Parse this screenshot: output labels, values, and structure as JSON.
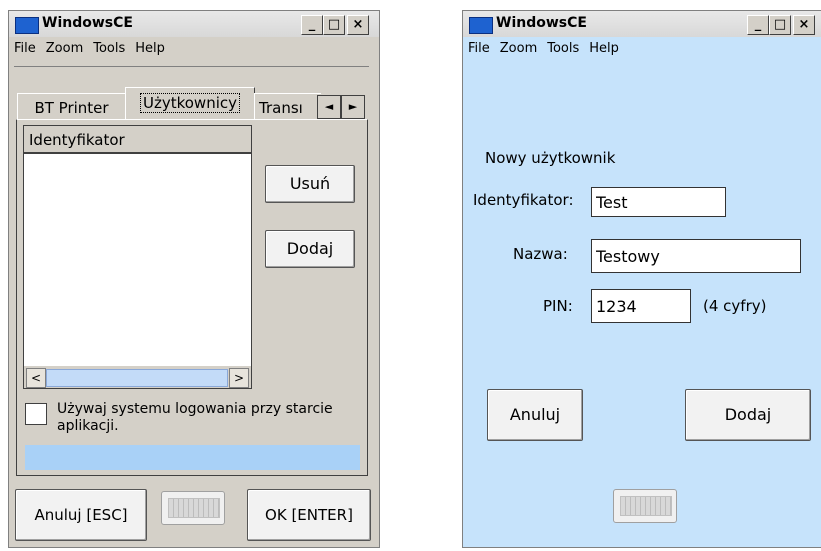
{
  "left_window": {
    "title": "WindowsCE",
    "controls": {
      "minimize": "_",
      "maximize": "□",
      "close": "×"
    },
    "menu": [
      "File",
      "Zoom",
      "Tools",
      "Help"
    ],
    "tabs": [
      {
        "label": "BT Printer",
        "selected": false
      },
      {
        "label": "Użytkownicy",
        "selected": true
      },
      {
        "label": "Transı",
        "selected": false
      }
    ],
    "tab_scroll": {
      "left": "◄",
      "right": "►"
    },
    "list_header": "Identyfikator",
    "hscroll": {
      "left": "<",
      "right": ">"
    },
    "buttons": {
      "remove": "Usuń",
      "add": "Dodaj"
    },
    "checkbox_label": "Używaj systemu logowania przy starcie aplikacji.",
    "checkbox_checked": false,
    "bottom": {
      "cancel": "Anuluj [ESC]",
      "ok": "OK [ENTER]"
    }
  },
  "right_window": {
    "title": "WindowsCE",
    "controls": {
      "minimize": "_",
      "maximize": "□",
      "close": "×"
    },
    "menu": [
      "File",
      "Zoom",
      "Tools",
      "Help"
    ],
    "heading": "Nowy użytkownik",
    "fields": {
      "id_label": "Identyfikator:",
      "id_value": "Test",
      "name_label": "Nazwa:",
      "name_value": "Testowy",
      "pin_label": "PIN:",
      "pin_value": "1234",
      "pin_hint": "(4 cyfry)"
    },
    "buttons": {
      "cancel": "Anuluj",
      "add": "Dodaj"
    },
    "background": "#c6e3fb"
  }
}
